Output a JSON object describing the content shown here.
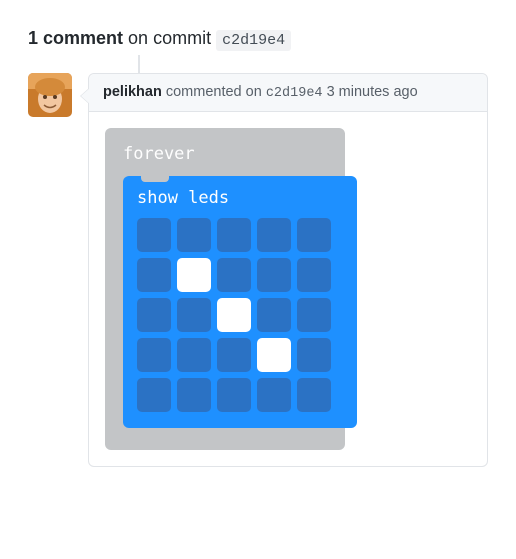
{
  "header": {
    "count_text": "1 comment",
    "on_commit_text": "on commit",
    "commit_hash": "c2d19e4"
  },
  "comment": {
    "author": "pelikhan",
    "verb": "commented on",
    "commit_hash": "c2d19e4",
    "time": "3 minutes ago"
  },
  "blocks": {
    "forever_label": "forever",
    "show_leds_label": "show leds",
    "led_grid": [
      [
        0,
        0,
        0,
        0,
        0
      ],
      [
        0,
        1,
        0,
        0,
        0
      ],
      [
        0,
        0,
        1,
        0,
        0
      ],
      [
        0,
        0,
        0,
        1,
        0
      ],
      [
        0,
        0,
        0,
        0,
        0
      ]
    ]
  },
  "colors": {
    "block_outer": "#c3c5c7",
    "block_inner": "#1e90ff",
    "led_off": "#2b72c4",
    "led_on": "#ffffff"
  }
}
